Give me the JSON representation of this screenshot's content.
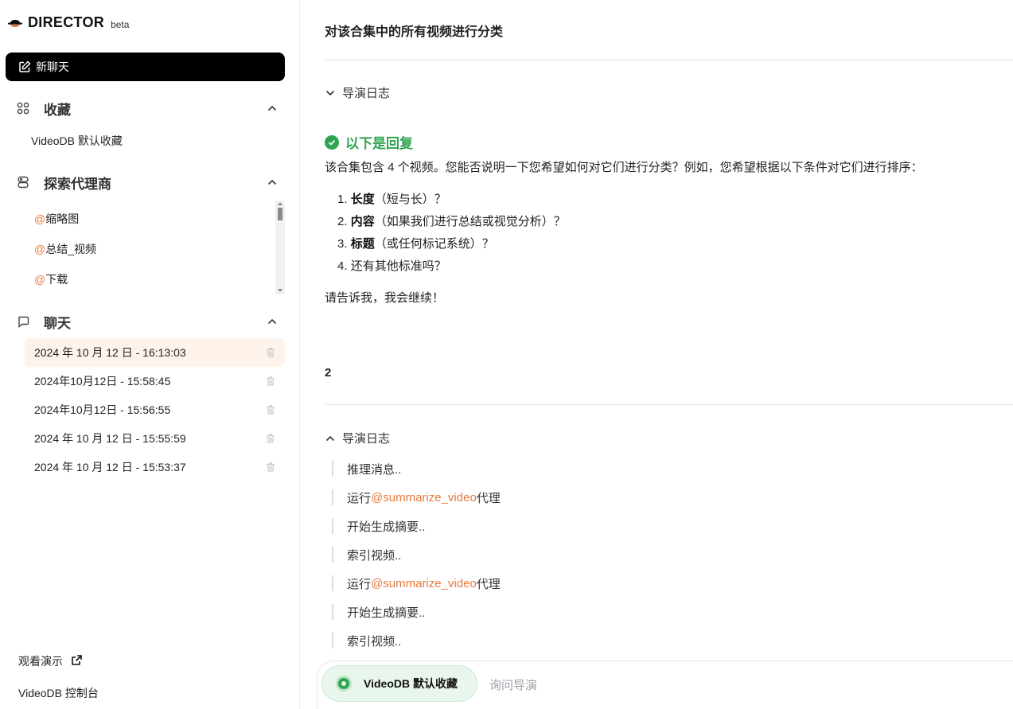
{
  "app": {
    "name": "DIRECTOR",
    "badge": "beta"
  },
  "sidebar": {
    "new_chat_label": "新聊天",
    "collections": {
      "title": "收藏",
      "items": [
        "VideoDB 默认收藏"
      ]
    },
    "agents": {
      "title": "探索代理商",
      "items": [
        {
          "prefix": "@",
          "name": "缩略图"
        },
        {
          "prefix": "@",
          "name": "总结_视频"
        },
        {
          "prefix": "@",
          "name": "下载"
        }
      ]
    },
    "chats": {
      "title": "聊天",
      "items": [
        "2024 年 10 月 12 日 - 16:13:03",
        "2024年10月12日 - 15:58:45",
        "2024年10月12日 - 15:56:55",
        "2024 年 10 月 12 日 - 15:55:59",
        "2024 年 10 月 12 日 - 15:53:37"
      ]
    },
    "footer": {
      "demo_label": "观看演示",
      "console_label": "VideoDB 控制台"
    }
  },
  "main": {
    "title": "对该合集中的所有视频进行分类",
    "log_label": "导演日志",
    "reply": {
      "heading": "以下是回复",
      "intro": "该合集包含 4 个视频。您能否说明一下您希望如何对它们进行分类？例如，您希望根据以下条件对它们进行排序：",
      "list": [
        {
          "num": "1.",
          "bold": "长度",
          "rest": "（短与长）？"
        },
        {
          "num": "2.",
          "bold": "内容",
          "rest": "（如果我们进行总结或视觉分析）？"
        },
        {
          "num": "3.",
          "bold": "标题",
          "rest": "（或任何标记系统）？"
        },
        {
          "num": "4.",
          "bold": "",
          "rest": "还有其他标准吗？"
        }
      ],
      "closing": "请告诉我，我会继续！"
    },
    "user_message": "2",
    "log_label_2": "导演日志",
    "log_lines": [
      {
        "text_before": "推理消息..",
        "agent": "",
        "text_after": ""
      },
      {
        "text_before": "运行",
        "agent": "@summarize_video",
        "text_after": "代理"
      },
      {
        "text_before": "开始生成摘要..",
        "agent": "",
        "text_after": ""
      },
      {
        "text_before": "索引视频..",
        "agent": "",
        "text_after": ""
      },
      {
        "text_before": "运行",
        "agent": "@summarize_video",
        "text_after": "代理"
      },
      {
        "text_before": "开始生成摘要..",
        "agent": "",
        "text_after": ""
      },
      {
        "text_before": "索引视频..",
        "agent": "",
        "text_after": ""
      }
    ]
  },
  "input": {
    "collection_label": "VideoDB 默认收藏",
    "placeholder": "询问导演"
  },
  "colors": {
    "accent": "#e8793d",
    "success": "#2ea44f",
    "active_chat_bg": "#fdf3ea"
  }
}
